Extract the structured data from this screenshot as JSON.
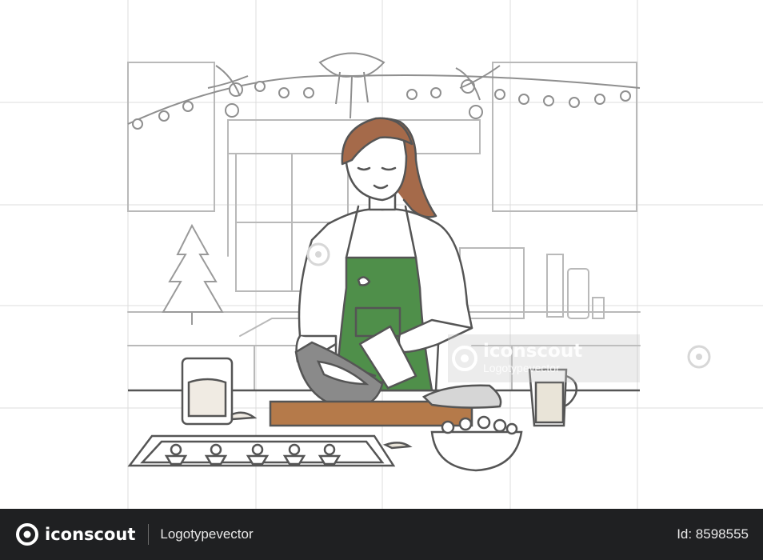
{
  "colors": {
    "line": "#5a5a5a",
    "apron": "#4f8f4a",
    "hair": "#a56a4a",
    "board": "#b57a4a",
    "bowl": "#8a8a8a",
    "footer_bg": "#1f2022"
  },
  "watermark": {
    "brand": "iconscout",
    "author": "Logotypevector"
  },
  "footer": {
    "brand": "iconscout",
    "author": "Logotypevector",
    "id_label": "Id: 8598555"
  },
  "icons": [
    "iconscout-logo-icon",
    "watermark-logo-icon"
  ]
}
